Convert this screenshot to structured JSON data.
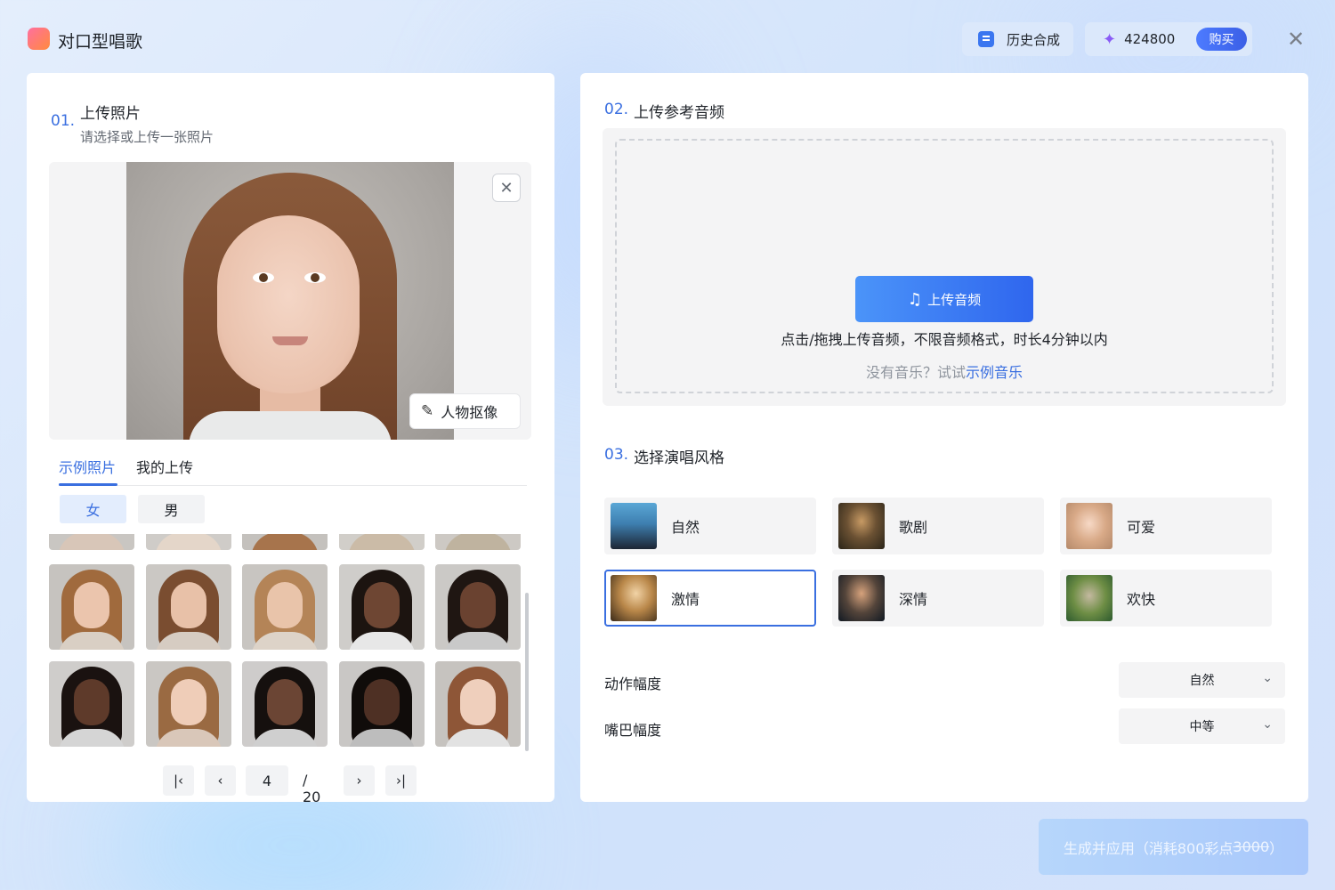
{
  "app": {
    "title": "对口型唱歌"
  },
  "header": {
    "history_label": "历史合成",
    "credits": "424800",
    "buy_label": "购买"
  },
  "step1": {
    "num": "01.",
    "title": "上传照片",
    "subtitle": "请选择或上传一张照片",
    "cutout_label": "人物抠像",
    "tabs": [
      "示例照片",
      "我的上传"
    ],
    "genders": [
      "女",
      "男"
    ]
  },
  "pagination": {
    "current": "4",
    "total": "/ 20"
  },
  "step2": {
    "num": "02.",
    "title": "上传参考音频",
    "upload_label": "上传音频",
    "hint": "点击/拖拽上传音频，不限音频格式，时长4分钟以内",
    "sample_prefix": "没有音乐？试试",
    "sample_link": "示例音乐"
  },
  "step3": {
    "num": "03.",
    "title": "选择演唱风格",
    "styles": [
      "自然",
      "歌剧",
      "可爱",
      "激情",
      "深情",
      "欢快"
    ],
    "selected_style": "激情"
  },
  "settings": {
    "motion_label": "动作幅度",
    "motion_value": "自然",
    "mouth_label": "嘴巴幅度",
    "mouth_value": "中等"
  },
  "generate": {
    "label": "生成并应用（消耗800彩点",
    "original_cost": "3000",
    "suffix": "）"
  },
  "colors": {
    "accent": "#3a6fe0",
    "primary_button": "#2f66ee"
  }
}
